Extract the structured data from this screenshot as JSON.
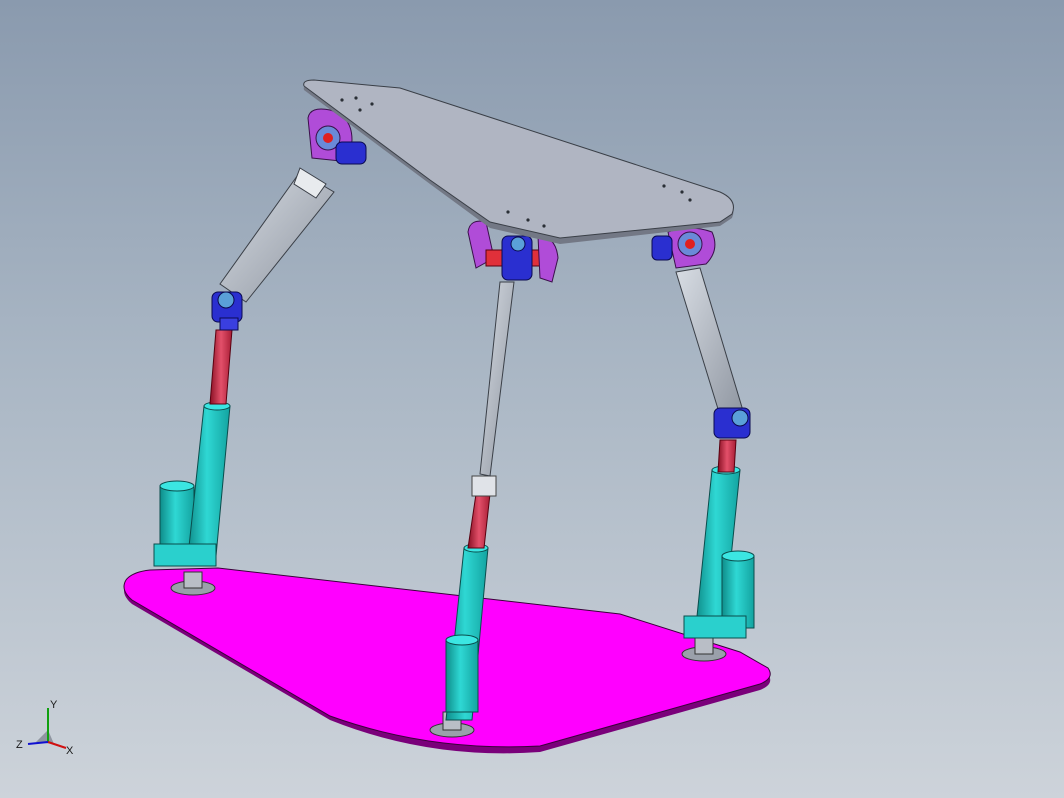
{
  "viewport": {
    "background_top": "#8a9aae",
    "background_bottom": "#cdd3da"
  },
  "model": {
    "colors": {
      "base_plate": "#ff00ff",
      "top_plate": "#b0b5c2",
      "actuator_body": "#1fc3c0",
      "actuator_rod": "#d42a4a",
      "u_joint": "#2a2fd0",
      "mount": "#b04cd8",
      "link": "#b8bec9"
    }
  },
  "triad": {
    "x_label": "X",
    "y_label": "Y",
    "z_label": "Z",
    "x_color": "#d01010",
    "y_color": "#10a010",
    "z_color": "#1010d0"
  }
}
